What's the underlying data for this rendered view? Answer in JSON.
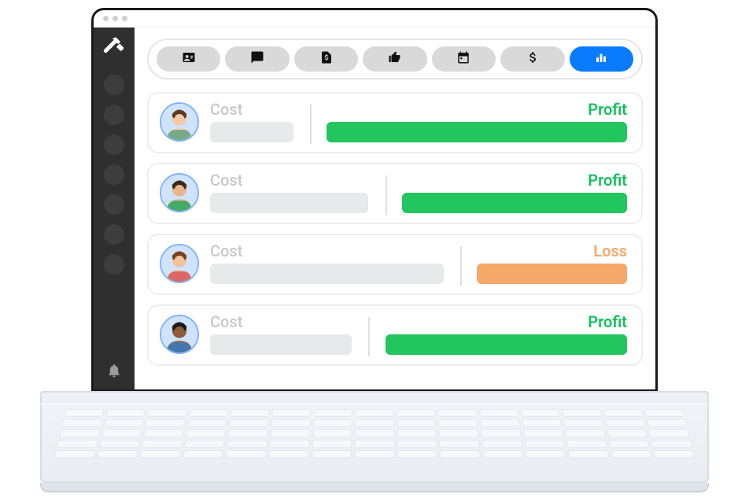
{
  "sidebar": {
    "logo_icon": "hammer-icon",
    "nav_placeholder_count": 7,
    "footer_icon": "bell-icon"
  },
  "tabs": [
    {
      "icon": "id-card-icon",
      "active": false
    },
    {
      "icon": "chat-icon",
      "active": false
    },
    {
      "icon": "invoice-icon",
      "active": false
    },
    {
      "icon": "thumbs-up-icon",
      "active": false
    },
    {
      "icon": "calendar-icon",
      "active": false
    },
    {
      "icon": "dollar-icon",
      "active": false
    },
    {
      "icon": "bar-chart-icon",
      "active": true
    }
  ],
  "labels": {
    "cost": "Cost",
    "profit": "Profit",
    "loss": "Loss"
  },
  "colors": {
    "profit": "#22c55e",
    "loss": "#f4a96a",
    "cost_bar": "#e7e9eb",
    "tab_inactive": "#d9d9d9",
    "tab_active": "#0a7bff"
  },
  "rows": [
    {
      "avatar": "person-1",
      "cost_pct": 20,
      "divider_pct": 24,
      "result_pct": 72,
      "result": "profit"
    },
    {
      "avatar": "person-2",
      "cost_pct": 38,
      "divider_pct": 42,
      "result_pct": 54,
      "result": "profit"
    },
    {
      "avatar": "person-3",
      "cost_pct": 56,
      "divider_pct": 60,
      "result_pct": 36,
      "result": "loss"
    },
    {
      "avatar": "person-4",
      "cost_pct": 34,
      "divider_pct": 38,
      "result_pct": 58,
      "result": "profit"
    }
  ]
}
